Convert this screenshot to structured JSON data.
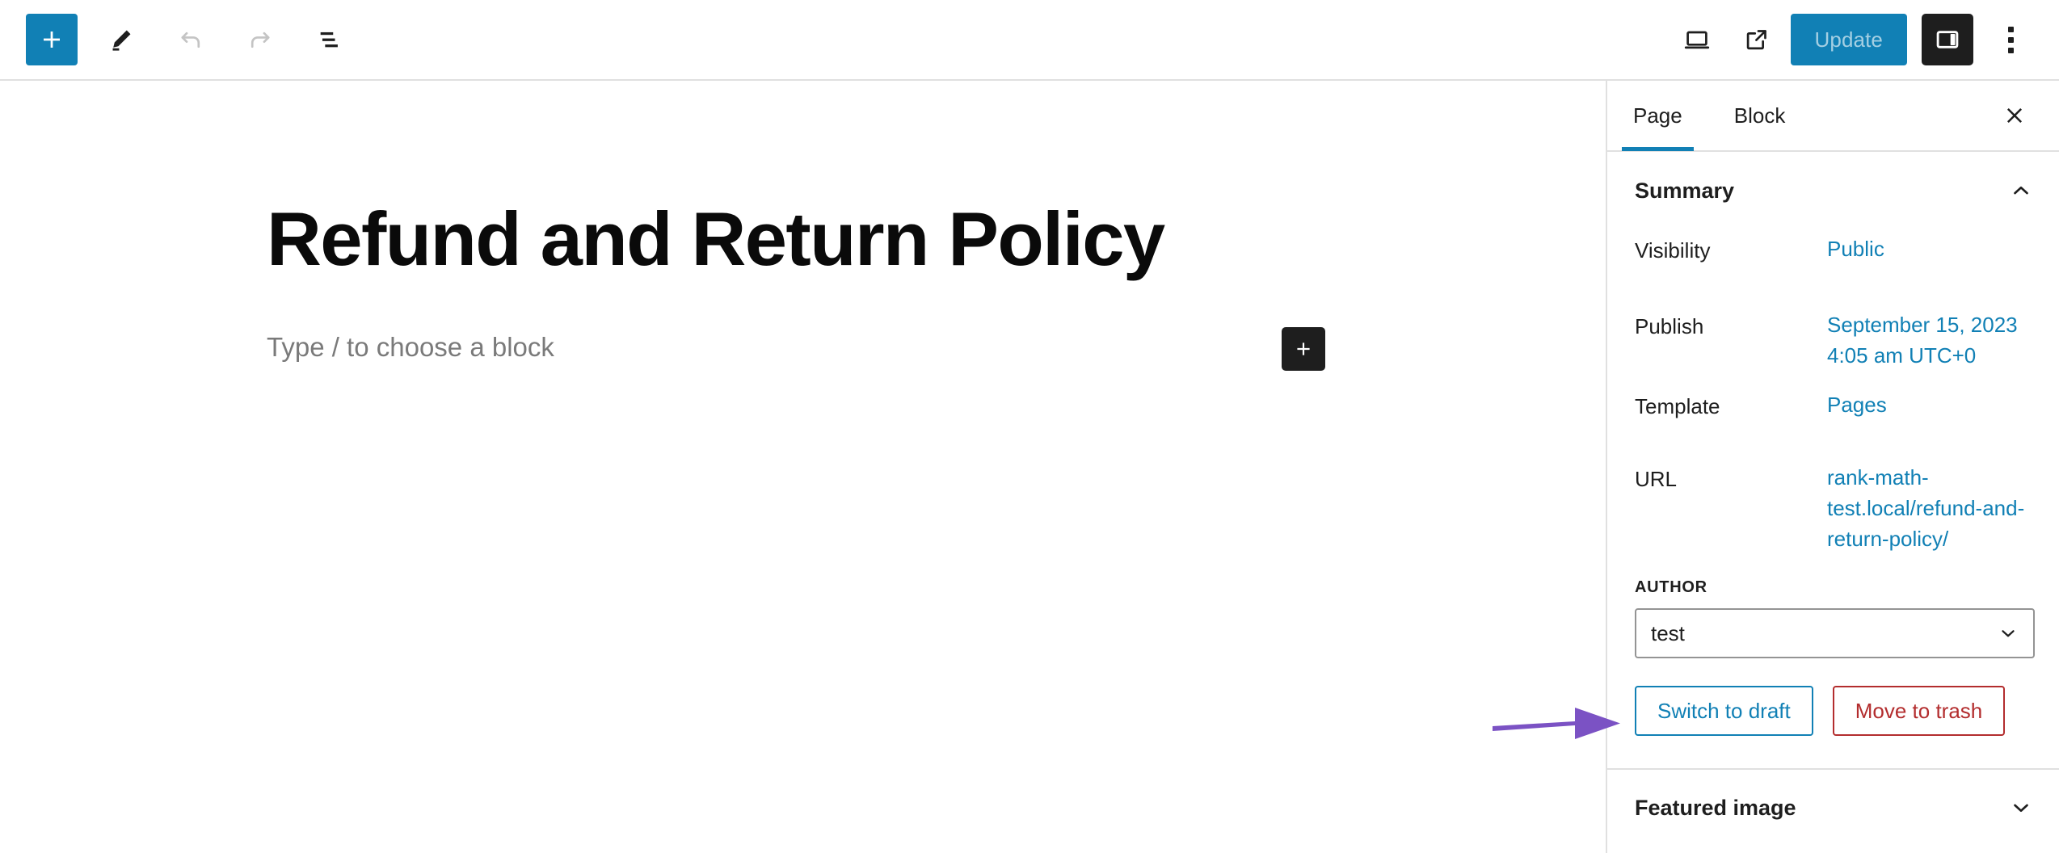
{
  "toolbar": {
    "add_block_label": "Add block",
    "add_block_icon": "plus-icon",
    "edit_tool_icon": "pencil-icon",
    "undo_icon": "undo-icon",
    "redo_icon": "redo-icon",
    "list_view_icon": "list-view-icon",
    "view_icon": "desktop-view-icon",
    "preview_icon": "external-link-icon",
    "update_label": "Update",
    "sidebar_toggle_icon": "sidebar-panel-icon",
    "options_icon": "three-dots-vertical-icon"
  },
  "editor": {
    "title": "Refund and Return Policy",
    "paragraph_placeholder": "Type / to choose a block",
    "inserter_icon": "plus-icon"
  },
  "sidebar": {
    "tabs": [
      {
        "label": "Page",
        "active": true
      },
      {
        "label": "Block",
        "active": false
      }
    ],
    "close_icon": "close-icon",
    "summary": {
      "title": "Summary",
      "chevron_icon": "chevron-up-icon",
      "rows": [
        {
          "label": "Visibility",
          "value": "Public"
        },
        {
          "label": "Publish",
          "value": "September 15, 2023 4:05 am UTC+0"
        },
        {
          "label": "Template",
          "value": "Pages"
        },
        {
          "label": "URL",
          "value": "rank-math-test.local/refund-and-return-policy/"
        }
      ],
      "author": {
        "label": "AUTHOR",
        "value": "test",
        "chevron_icon": "chevron-down-icon"
      },
      "actions": {
        "switch_to_draft": "Switch to draft",
        "move_to_trash": "Move to trash"
      }
    },
    "featured_image": {
      "title": "Featured image",
      "chevron_icon": "chevron-down-icon"
    }
  },
  "annotation": {
    "arrow_color": "#7b52c4",
    "points_to": "Switch to draft"
  },
  "colors": {
    "accent_blue": "#1180b5",
    "danger_red": "#b32d2e",
    "dark": "#1e1e1e",
    "border": "#e0e0e0",
    "annotation_purple": "#7b52c4"
  }
}
